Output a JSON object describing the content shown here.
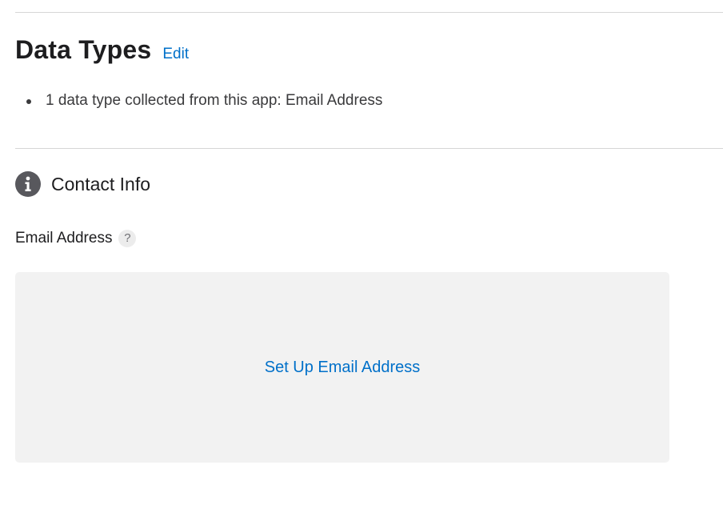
{
  "data_types": {
    "title": "Data Types",
    "edit_label": "Edit",
    "summary": [
      "1 data type collected from this app: Email Address"
    ]
  },
  "categories": [
    {
      "icon": "info-icon",
      "label": "Contact Info",
      "fields": [
        {
          "label": "Email Address",
          "help_label": "?",
          "action_label": "Set Up Email Address"
        }
      ]
    }
  ],
  "colors": {
    "link": "#0070c9",
    "icon": "#58585d",
    "panel": "#f2f2f2",
    "divider": "#d6d6d6"
  }
}
